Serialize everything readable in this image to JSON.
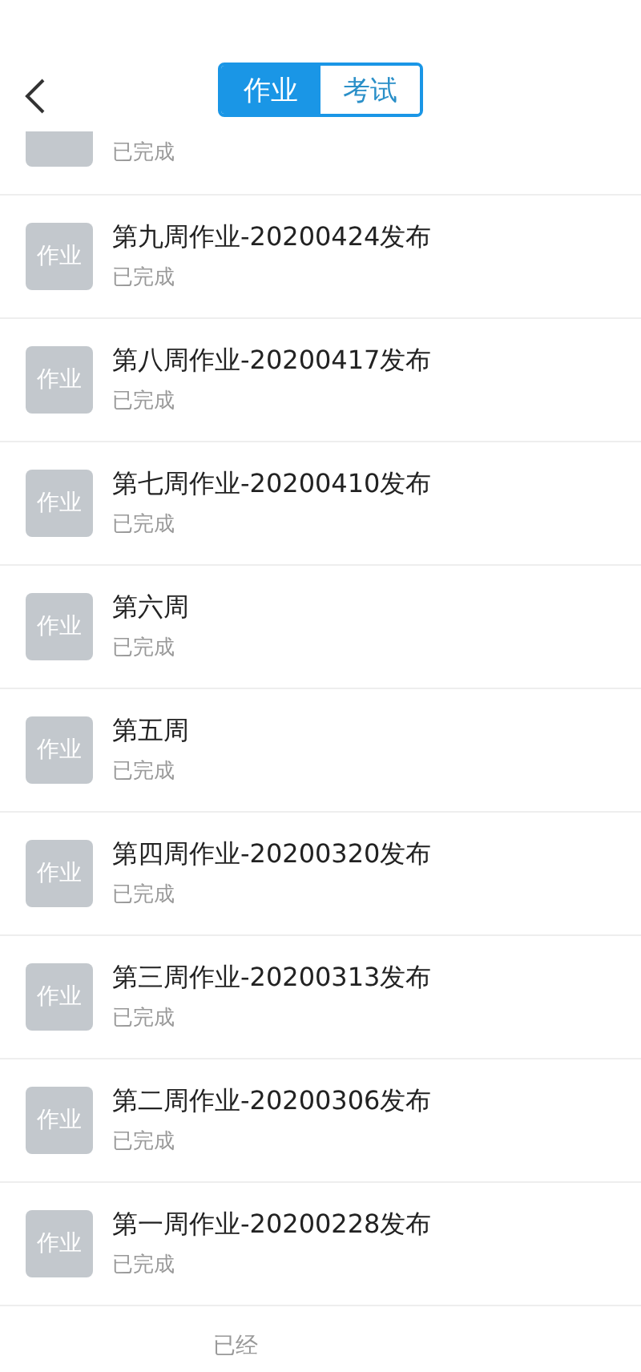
{
  "header": {
    "tabs": [
      {
        "label": "作业",
        "selected": true
      },
      {
        "label": "考试",
        "selected": false
      }
    ]
  },
  "assignments": [
    {
      "status": "已完成"
    },
    {
      "badge": "作业",
      "title": "第九周作业-20200424发布",
      "status": "已完成"
    },
    {
      "badge": "作业",
      "title": "第八周作业-20200417发布",
      "status": "已完成"
    },
    {
      "badge": "作业",
      "title": "第七周作业-20200410发布",
      "status": "已完成"
    },
    {
      "badge": "作业",
      "title": "第六周",
      "status": "已完成"
    },
    {
      "badge": "作业",
      "title": "第五周",
      "status": "已完成"
    },
    {
      "badge": "作业",
      "title": "第四周作业-20200320发布",
      "status": "已完成"
    },
    {
      "badge": "作业",
      "title": "第三周作业-20200313发布",
      "status": "已完成"
    },
    {
      "badge": "作业",
      "title": "第二周作业-20200306发布",
      "status": "已完成"
    },
    {
      "badge": "作业",
      "title": "第一周作业-20200228发布",
      "status": "已完成"
    }
  ],
  "footer": "已经"
}
